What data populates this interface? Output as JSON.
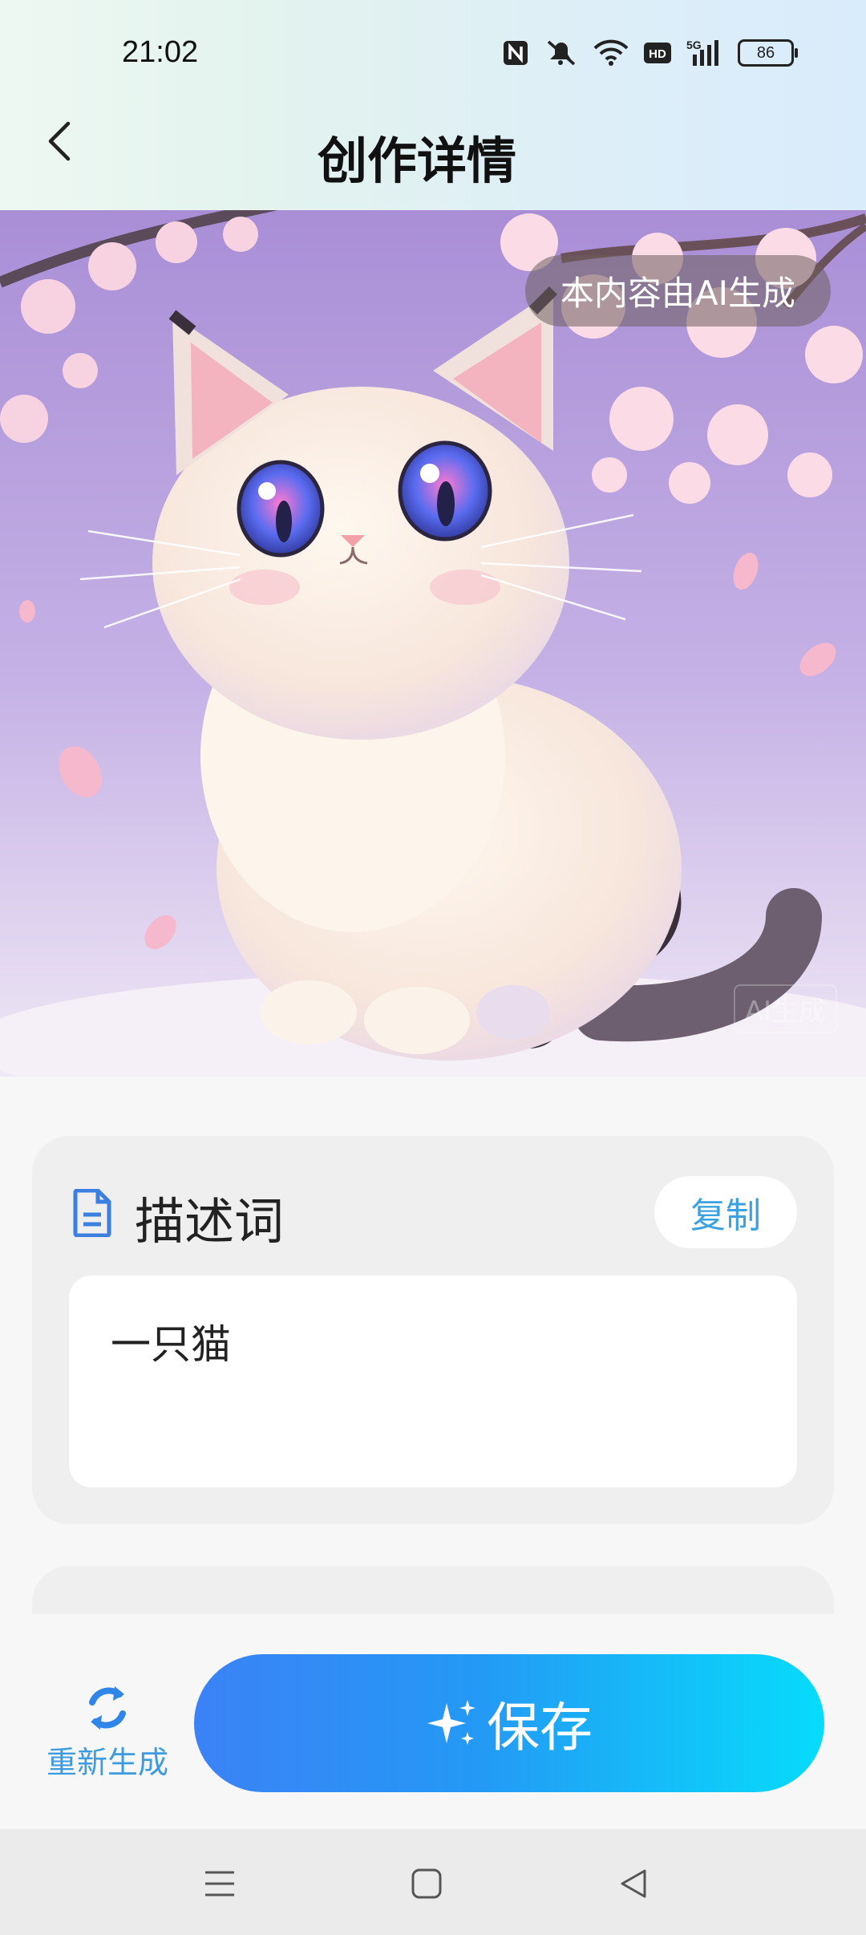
{
  "status_bar": {
    "time": "21:02",
    "battery": "86",
    "icons": [
      "nfc-icon",
      "mute-icon",
      "wifi-icon",
      "hd-icon",
      "signal-5g-icon"
    ],
    "hd_label": "HD",
    "network_label": "5G"
  },
  "header": {
    "title": "创作详情"
  },
  "hero": {
    "ai_badge": "本内容由AI生成",
    "watermark": "AI生成"
  },
  "description": {
    "title": "描述词",
    "copy_label": "复制",
    "prompt_text": "一只猫"
  },
  "actions": {
    "regenerate_label": "重新生成",
    "save_label": "保存"
  },
  "colors": {
    "accent": "#3d9be0",
    "save_gradient_start": "#3b82f6",
    "save_gradient_end": "#06dcfb"
  }
}
